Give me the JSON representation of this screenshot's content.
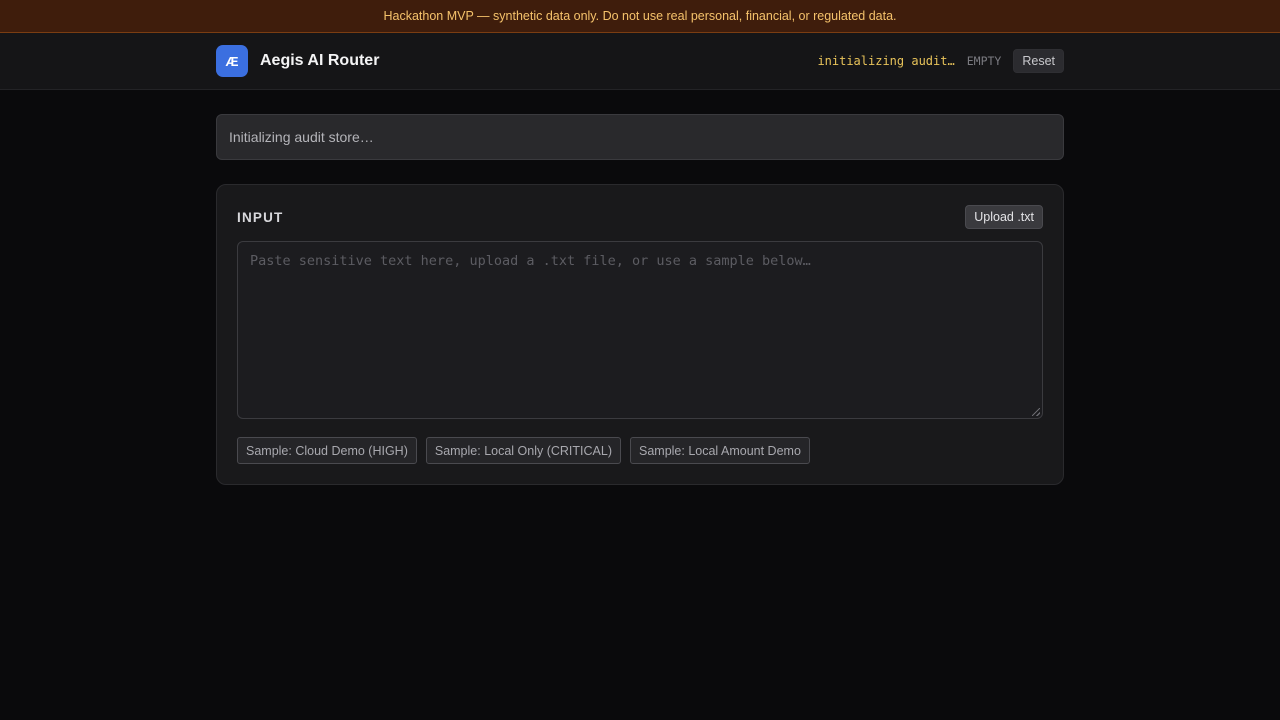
{
  "banner": {
    "text": "Hackathon MVP — synthetic data only. Do not use real personal, financial, or regulated data."
  },
  "header": {
    "logo_text": "Æ",
    "app_name": "Aegis AI Router",
    "audit_status": "initializing audit…",
    "count_status": "EMPTY",
    "reset_label": "Reset"
  },
  "notice": {
    "text": "Initializing audit store…"
  },
  "input_card": {
    "title": "INPUT",
    "upload_label": "Upload .txt",
    "textarea": {
      "value": "",
      "placeholder": "Paste sensitive text here, upload a .txt file, or use a sample below…"
    },
    "samples": [
      {
        "label": "Sample: Cloud Demo (HIGH)"
      },
      {
        "label": "Sample: Local Only (CRITICAL)"
      },
      {
        "label": "Sample: Local Amount Demo"
      }
    ]
  },
  "colors": {
    "banner_bg": "#3f1d0c",
    "banner_text": "#f5c26b",
    "accent": "#3b6fe0",
    "audit_status": "#e8c35a",
    "page_bg": "#0a0a0c"
  }
}
